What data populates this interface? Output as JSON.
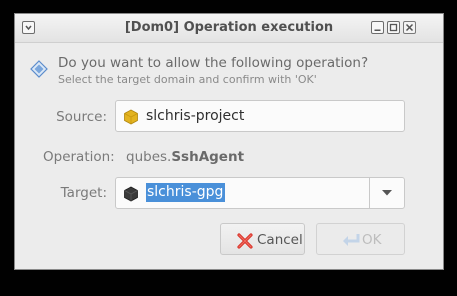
{
  "window": {
    "title": "[Dom0] Operation execution",
    "titlebar_icons": [
      "window-menu-icon",
      "minimize-icon",
      "maximize-icon",
      "close-icon"
    ]
  },
  "dialog": {
    "question": "Do you want to allow the following operation?",
    "hint": "Select the target domain and confirm with 'OK'",
    "source_label": "Source:",
    "source_value": "slchris-project",
    "source_icon_color": "#e3b320",
    "operation_label": "Operation:",
    "operation_prefix": "qubes.",
    "operation_name": "SshAgent",
    "target_label": "Target:",
    "target_value": "slchris-gpg",
    "target_icon_color": "#3a3a3a",
    "selection_color": "#4a90d9"
  },
  "buttons": {
    "cancel": "Cancel",
    "ok": "OK"
  }
}
